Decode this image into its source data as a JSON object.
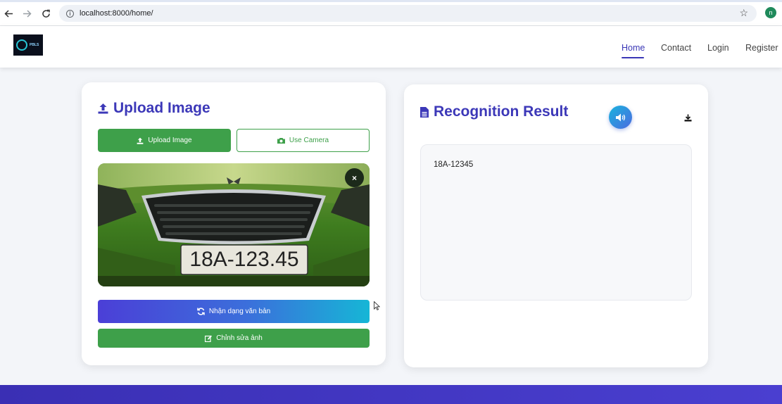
{
  "browser": {
    "url": "localhost:8000/home/",
    "profile_initial": "n"
  },
  "header": {
    "logo_text": "PBLS",
    "nav": [
      {
        "label": "Home",
        "active": true
      },
      {
        "label": "Contact",
        "active": false
      },
      {
        "label": "Login",
        "active": false
      },
      {
        "label": "Register",
        "active": false
      }
    ]
  },
  "upload": {
    "title": "Upload Image",
    "upload_button": "Upload Image",
    "camera_button": "Use Camera",
    "close_symbol": "×",
    "plate_text": "18A-123.45",
    "recognize_button": "Nhận dạng văn bản",
    "edit_button": "Chỉnh sửa ảnh"
  },
  "result": {
    "title": "Recognition Result",
    "text": "18A-12345"
  },
  "colors": {
    "brand": "#3c38b8",
    "success": "#3ea04a",
    "gradient_start": "#4b3fd7",
    "gradient_end": "#16b6d6"
  },
  "icons": [
    "back-arrow-icon",
    "forward-arrow-icon",
    "reload-icon",
    "info-icon",
    "star-icon",
    "upload-icon",
    "camera-icon",
    "close-icon",
    "sync-icon",
    "edit-icon",
    "document-icon",
    "volume-icon",
    "download-icon"
  ]
}
